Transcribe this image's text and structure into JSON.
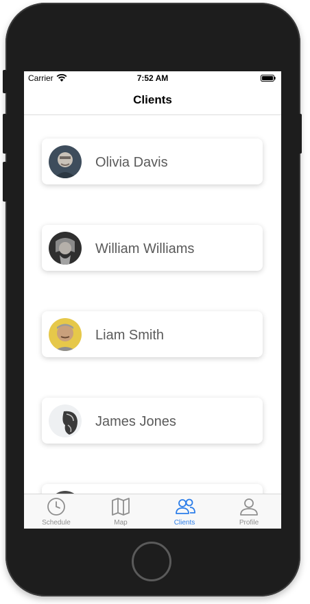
{
  "status_bar": {
    "carrier": "Carrier",
    "time": "7:52 AM"
  },
  "nav": {
    "title": "Clients"
  },
  "clients": [
    {
      "name": "Olivia Davis"
    },
    {
      "name": "William Williams"
    },
    {
      "name": "Liam Smith"
    },
    {
      "name": "James Jones"
    }
  ],
  "tabs": [
    {
      "label": "Schedule",
      "icon": "clock-icon",
      "active": false
    },
    {
      "label": "Map",
      "icon": "map-icon",
      "active": false
    },
    {
      "label": "Clients",
      "icon": "users-icon",
      "active": true
    },
    {
      "label": "Profile",
      "icon": "person-icon",
      "active": false
    }
  ],
  "colors": {
    "accent": "#2b7de9",
    "inactive": "#8e8e8e",
    "device": "#1d1d1d"
  }
}
